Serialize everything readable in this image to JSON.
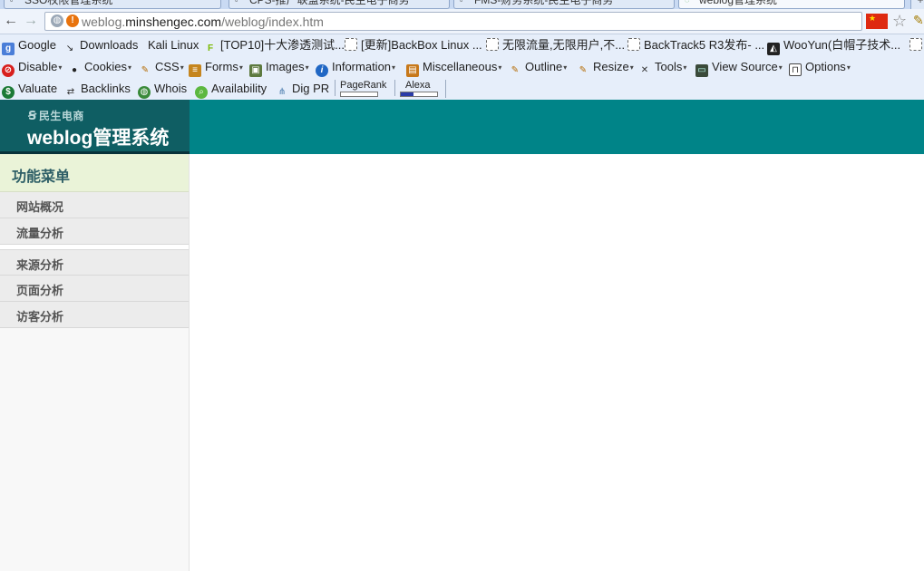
{
  "browser": {
    "tabs": [
      {
        "title": "SSO权限管理系统",
        "active": false
      },
      {
        "title": "CPS-推广联盟系统-民生电子商务",
        "active": false
      },
      {
        "title": "FMS-财务系统-民生电子商务",
        "active": false
      },
      {
        "title": "weblog管理系统",
        "active": true
      }
    ],
    "new_tab_label": "+",
    "close_glyph": "×",
    "back_label": "←",
    "forward_label": "→",
    "url_prefix": "weblog.",
    "url_host": "minshengec.com",
    "url_path": "/weblog/index.htm"
  },
  "bookmarks": [
    {
      "label": "Google",
      "icon": "google-icon"
    },
    {
      "label": "Downloads",
      "icon": "download-icon"
    },
    {
      "label": "Kali Linux",
      "icon": ""
    },
    {
      "label": "[TOP10]十大渗透测试...",
      "icon": "f-icon"
    },
    {
      "label": "[更新]BackBox Linux ...",
      "icon": "blank-page-icon"
    },
    {
      "label": "无限流量,无限用户,不...",
      "icon": "blank-page-icon"
    },
    {
      "label": "BackTrack5 R3发布- ...",
      "icon": "blank-page-icon"
    },
    {
      "label": "WooYun(白帽子技术...",
      "icon": "wooyun-icon"
    }
  ],
  "webdev_toolbar": [
    {
      "label": "Disable",
      "icon": "disable-icon"
    },
    {
      "label": "Cookies",
      "icon": "cookie-icon"
    },
    {
      "label": "CSS",
      "icon": "css-icon"
    },
    {
      "label": "Forms",
      "icon": "forms-icon"
    },
    {
      "label": "Images",
      "icon": "images-icon"
    },
    {
      "label": "Information",
      "icon": "info-icon"
    },
    {
      "label": "Miscellaneous",
      "icon": "misc-icon"
    },
    {
      "label": "Outline",
      "icon": "outline-icon"
    },
    {
      "label": "Resize",
      "icon": "resize-icon"
    },
    {
      "label": "Tools",
      "icon": "tools-icon"
    },
    {
      "label": "View Source",
      "icon": "source-icon"
    },
    {
      "label": "Options",
      "icon": "options-icon"
    }
  ],
  "seo_toolbar": [
    {
      "label": "Valuate",
      "icon": "dollar-icon"
    },
    {
      "label": "Backlinks",
      "icon": "backlinks-icon"
    },
    {
      "label": "Whois",
      "icon": "globe-icon"
    },
    {
      "label": "Availability",
      "icon": "search-icon"
    },
    {
      "label": "Dig PR",
      "icon": "network-icon"
    }
  ],
  "seo_meters": {
    "pagerank_label": "PageRank",
    "pagerank_level": 0,
    "alexa_label": "Alexa",
    "alexa_level": 0.35
  },
  "page": {
    "brand_sub": "民生电商",
    "site_title": "weblog管理系统",
    "menu_title": "功能菜单",
    "menu_items": [
      {
        "label": "网站概况"
      },
      {
        "label": "流量分析"
      },
      {
        "label": "来源分析"
      },
      {
        "label": "页面分析"
      },
      {
        "label": "访客分析"
      }
    ]
  },
  "colors": {
    "header_teal": "#008488",
    "logo_dark": "#0f5e63",
    "menu_head_bg": "#eaf3d8"
  }
}
